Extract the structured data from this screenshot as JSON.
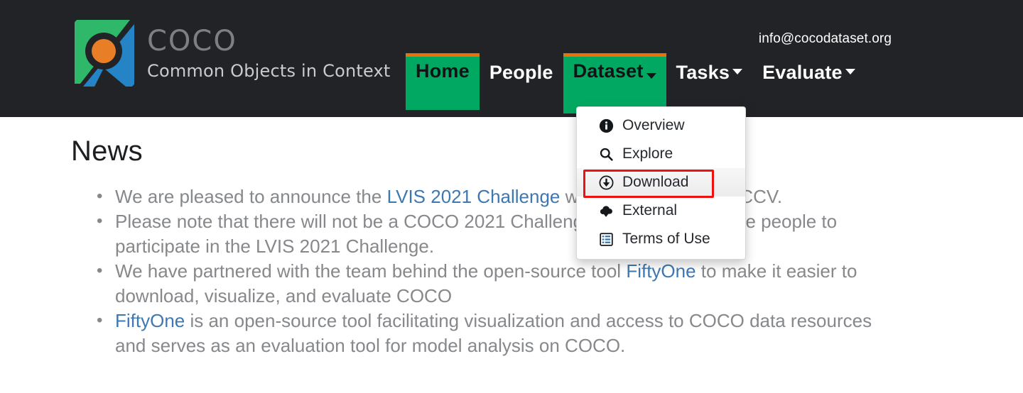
{
  "header": {
    "logo": {
      "title": "COCO",
      "subtitle": "Common Objects in Context",
      "colors": {
        "green": "#2fb86a",
        "blue": "#2484c6",
        "orange": "#e87e25",
        "dark": "#212326"
      }
    },
    "email": "info@cocodataset.org",
    "background": "#212326",
    "nav": [
      {
        "label": "Home",
        "state": "active",
        "caret": false
      },
      {
        "label": "People",
        "state": "plain",
        "caret": false
      },
      {
        "label": "Dataset",
        "state": "open",
        "caret": true
      },
      {
        "label": "Tasks",
        "state": "plain",
        "caret": true
      },
      {
        "label": "Evaluate",
        "state": "plain",
        "caret": true
      }
    ],
    "accent_top_border": "#e8720c",
    "active_bg": "#00a862"
  },
  "dropdown": {
    "owner": "Dataset",
    "items": [
      {
        "label": "Overview",
        "icon": "info-circle-icon",
        "highlighted": false
      },
      {
        "label": "Explore",
        "icon": "search-icon",
        "highlighted": false
      },
      {
        "label": "Download",
        "icon": "download-circle-icon",
        "highlighted": true
      },
      {
        "label": "External",
        "icon": "cloud-download-icon",
        "highlighted": false
      },
      {
        "label": "Terms of Use",
        "icon": "list-table-icon",
        "highlighted": false
      }
    ],
    "highlight_box_color": "#ee1111"
  },
  "main": {
    "title": "News",
    "news": [
      {
        "parts": [
          {
            "text": "We are pleased to announce the ",
            "link": false
          },
          {
            "text": "LVIS 2021 Challenge",
            "link": true
          },
          {
            "text": " which will be held at ICCV.",
            "link": false
          }
        ]
      },
      {
        "parts": [
          {
            "text": "Please note that there will not be a COCO 2021 Challenge, and we encourage people to participate in the LVIS 2021 Challenge.",
            "link": false
          }
        ]
      },
      {
        "parts": [
          {
            "text": "We have partnered with the team behind the open-source tool ",
            "link": false
          },
          {
            "text": "FiftyOne",
            "link": true
          },
          {
            "text": " to make it easier to download, visualize, and evaluate COCO",
            "link": false
          }
        ]
      },
      {
        "parts": [
          {
            "text": "FiftyOne",
            "link": true
          },
          {
            "text": " is an open-source tool facilitating visualization and access to COCO data resources and serves as an evaluation tool for model analysis on COCO.",
            "link": false
          }
        ]
      }
    ],
    "text_color": "#86888b",
    "link_color": "#3e78b2"
  }
}
